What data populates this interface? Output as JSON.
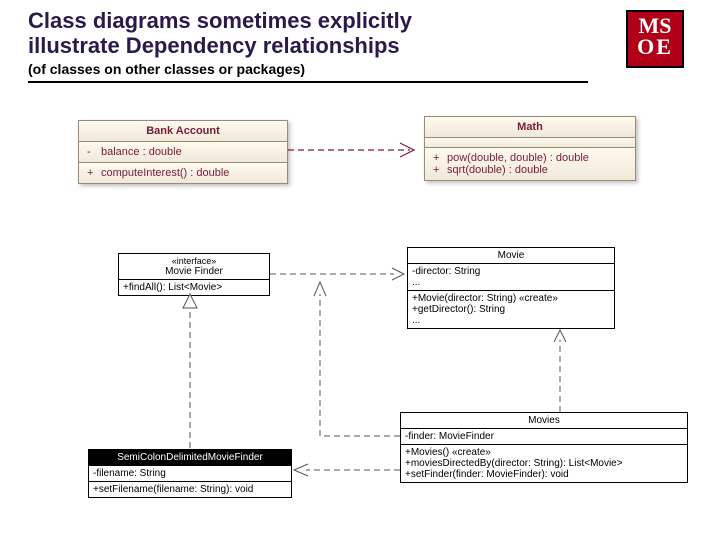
{
  "header": {
    "title_line1": "Class diagrams sometimes explicitly",
    "title_line2": "illustrate Dependency relationships",
    "subtitle": "(of classes on other classes or packages)"
  },
  "logo": {
    "line1": "MS",
    "line2": "OE"
  },
  "bank": {
    "name": "Bank Account",
    "attr_vis": "-",
    "attr": "balance : double",
    "op_vis": "+",
    "op": "computeInterest() : double"
  },
  "math": {
    "name": "Math",
    "pow_vis": "+",
    "pow": "pow(double, double) : double",
    "sqrt_vis": "+",
    "sqrt": "sqrt(double) : double"
  },
  "finder": {
    "stereo": "«interface»",
    "name": "Movie Finder",
    "op": "+findAll(): List<Movie>"
  },
  "movie": {
    "name": "Movie",
    "attr1": "-director: String",
    "attr2": "...",
    "op1": "+Movie(director: String) «create»",
    "op2": "+getDirector(): String",
    "op3": "..."
  },
  "movies": {
    "name": "Movies",
    "attr": "-finder: MovieFinder",
    "op1": "+Movies() «create»",
    "op2": "+moviesDirectedBy(director: String): List<Movie>",
    "op3": "+setFinder(finder: MovieFinder): void"
  },
  "semi": {
    "name": "SemiColonDelimitedMovieFinder",
    "attr": "-filename: String",
    "op": "+setFilename(filename: String): void"
  }
}
